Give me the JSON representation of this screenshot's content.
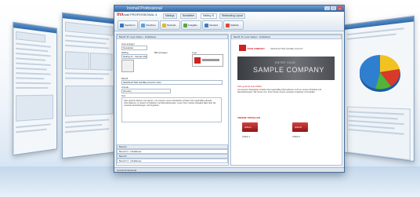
{
  "main_window": {
    "title": "Inxmail Professional",
    "brand_prefix": "inx",
    "brand_rest": "mail PROFESSIONAL 4",
    "tabs": [
      "Mailings",
      "Newsletter",
      "Mailing 01",
      "Webmailing Layout"
    ],
    "toolbar": [
      "Speichern",
      "Vorschau",
      "Testmail",
      "Freigabe",
      "Versand",
      "Statistik"
    ],
    "left_pane": {
      "header": "Betreff: Ihr neuer Kasten - Inhaltsleser",
      "fields": [
        {
          "label": "Liste anlegen",
          "value": "Newsletter"
        },
        {
          "label": "Mailing",
          "value": "Mailing 01 - Sample Mail"
        }
      ],
      "option_label": "Bild anzeigen",
      "logo_label": "Logo",
      "subject_label": "Betreff",
      "subject_value": "NEWSLETTER ADOBE AUGUST 2012",
      "salutation_label": "Anrede",
      "salutation_value": "[Anrede]",
      "body_label": "Text",
      "body_text": "Sehr geehrte Damen und Herren, mit unserem neuen Newsletter erhalten Sie regelmäßig aktuelle Informationen zu unseren Produkten und Dienstleistungen. Lesen Sie in dieser Ausgabe alles über die neuesten Entwicklungen und Angebote.",
      "sections": [
        "Bereich",
        "Bereich 2 - Inhaltsleser",
        "Bereich",
        "Bereich 3 - Inhaltsleser",
        "Bereich"
      ]
    },
    "right_pane": {
      "header": "Betreff: Ihr neuer Kasten - Inhaltsleser",
      "company_logo": "YOUR COMPANY",
      "newsletter_title": "NEWSLETTER ADOBE AUGUST",
      "banner_small": "ENTER YOUR",
      "banner_big": "SAMPLE COMPANY",
      "greeting": "Sehr geehrte Frau Müller,",
      "para": "mit unserem Newsletter erhalten Sie regelmäßig Informationen rund um unsere Produkte und Dienstleistungen. Wir freuen uns, Ihnen heute unsere neuesten Angebote vorzustellen.",
      "products_header": "UNSERE TOPSELLER",
      "product_labels": [
        "Artikel A",
        "Artikel B"
      ],
      "captions": [
        "Artikel 1",
        "Artikel 2"
      ]
    },
    "status": "Inxmail Professional"
  },
  "colors": {
    "accent_blue": "#2e63a2",
    "brand_red": "#c0272d",
    "pie_blue": "#2f7fd0",
    "pie_green": "#53b33a",
    "pie_yellow": "#f2c320",
    "pie_red": "#d83a2a"
  }
}
